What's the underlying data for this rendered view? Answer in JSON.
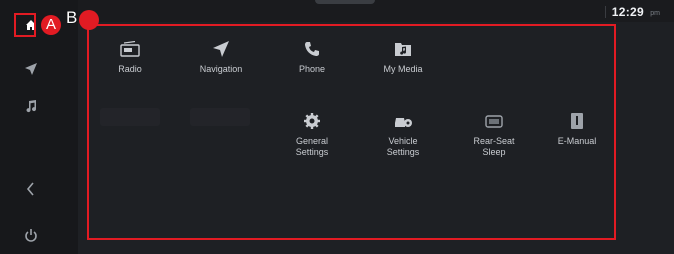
{
  "status": {
    "time": "12:29",
    "time_suffix": "pm"
  },
  "callouts": {
    "a": "A",
    "b": "B"
  },
  "apps": {
    "row1": [
      {
        "label": "Radio",
        "icon": "radio-icon"
      },
      {
        "label": "Navigation",
        "icon": "navigation-arrow-icon"
      },
      {
        "label": "Phone",
        "icon": "phone-handset-icon"
      },
      {
        "label": "My Media",
        "icon": "music-folder-icon"
      }
    ],
    "row2": [
      {
        "label": "General\nSettings",
        "icon": "gear-icon"
      },
      {
        "label": "Vehicle\nSettings",
        "icon": "car-gear-icon"
      },
      {
        "label": "Rear-Seat\nSleep",
        "icon": "rear-seat-icon"
      },
      {
        "label": "E-Manual",
        "icon": "book-icon"
      }
    ]
  },
  "sidebar": [
    "home-icon",
    "navigation-arrow-icon",
    "music-note-icon",
    "swipe-icon",
    "power-icon"
  ],
  "colors": {
    "accent": "#e21b23",
    "background": "#1e2024"
  }
}
